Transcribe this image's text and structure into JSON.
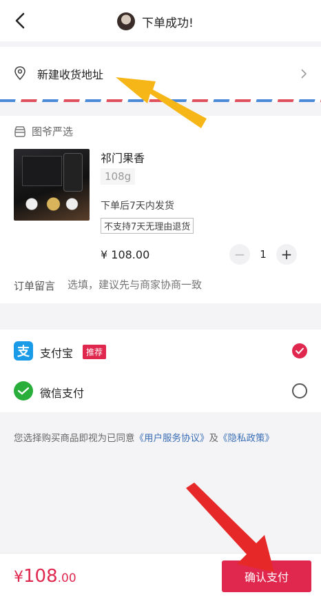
{
  "header": {
    "title": "下单成功!"
  },
  "address": {
    "label": "新建收货地址"
  },
  "shop": {
    "name": "图爷严选"
  },
  "product": {
    "title": "祁门果香",
    "spec": "108g",
    "shipping_note": "下单后7天内发货",
    "return_note": "不支持7天无理由退货",
    "price": "¥ 108.00",
    "quantity": "1",
    "minus_label": "−",
    "plus_label": "+"
  },
  "message": {
    "label": "订单留言",
    "placeholder": "选填，建议先与商家协商一致"
  },
  "payment": {
    "methods": [
      {
        "label": "支付宝",
        "badge": "推荐",
        "selected": true
      },
      {
        "label": "微信支付",
        "selected": false
      }
    ]
  },
  "agreement": {
    "prefix": "您选择购买商品即视为已同意",
    "link1": "《用户服务协议》",
    "and": "及",
    "link2": "《隐私政策》"
  },
  "footer": {
    "total_currency": "¥",
    "total_int": "108",
    "total_dec": ".00",
    "pay_label": "确认支付"
  },
  "colors": {
    "accent": "#e0284f",
    "alipay": "#1a9be8",
    "wechat": "#2aae3b",
    "link": "#3a6fb6"
  }
}
